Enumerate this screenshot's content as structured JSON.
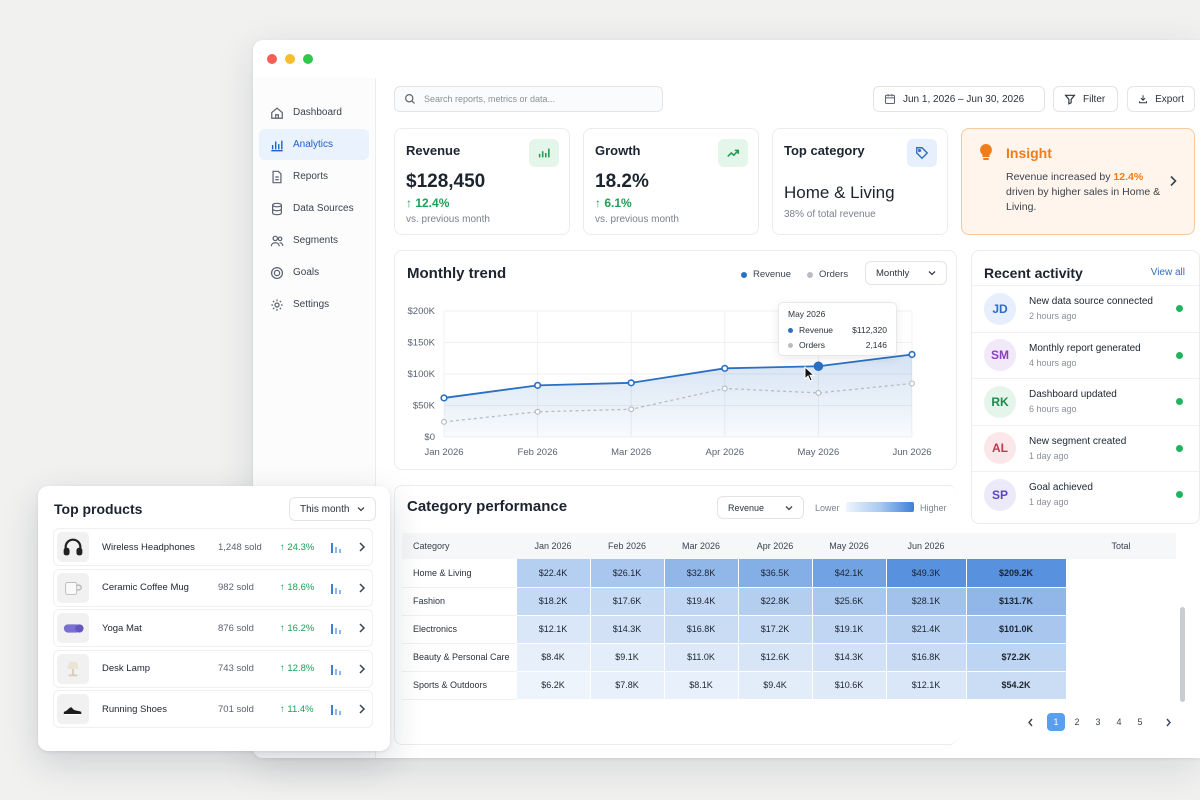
{
  "sidebar": {
    "items": [
      {
        "label": "Dashboard",
        "icon": "home-icon"
      },
      {
        "label": "Analytics",
        "icon": "bar-chart-icon"
      },
      {
        "label": "Reports",
        "icon": "document-icon"
      },
      {
        "label": "Data Sources",
        "icon": "database-icon"
      },
      {
        "label": "Segments",
        "icon": "users-icon"
      },
      {
        "label": "Goals",
        "icon": "target-icon"
      },
      {
        "label": "Settings",
        "icon": "gear-icon"
      }
    ]
  },
  "search": {
    "placeholder": "Search reports, metrics or data..."
  },
  "toolbar": {
    "date_range": "Jun 1, 2026 – Jun 30, 2026",
    "filter_label": "Filter",
    "export_label": "Export"
  },
  "kpis": {
    "revenue": {
      "title": "Revenue",
      "value": "$128,450",
      "change": "↑ 12.4%",
      "sub": "vs. previous month"
    },
    "growth": {
      "title": "Growth",
      "value": "18.2%",
      "change": "↑ 6.1%",
      "sub": "vs. previous month"
    },
    "top_category": {
      "title": "Top category",
      "value": "Home & Living",
      "sub": "38% of total revenue"
    }
  },
  "insight": {
    "title": "Insight",
    "text_before": "Revenue increased by ",
    "highlight": "12.4%",
    "text_after": " driven by higher sales in Home & Living.",
    "accent": "#f07d1a"
  },
  "trend": {
    "title": "Monthly trend",
    "legend_revenue": "Revenue",
    "legend_orders": "Orders",
    "period_select": "Monthly",
    "tooltip": {
      "month": "May 2026",
      "revenue_label": "Revenue",
      "revenue_value": "$112,320",
      "orders_label": "Orders",
      "orders_value": "2,146"
    }
  },
  "chart_data": {
    "type": "line",
    "x": [
      "Jan 2026",
      "Feb 2026",
      "Mar 2026",
      "Apr 2026",
      "May 2026",
      "Jun 2026"
    ],
    "yticks": [
      "$200K",
      "$150K",
      "$100K",
      "$50K",
      "$0"
    ],
    "ylim": [
      0,
      200000
    ],
    "series": [
      {
        "name": "Revenue",
        "values": [
          62000,
          82000,
          86000,
          109000,
          112320,
          131000
        ],
        "color": "#2a6fc4"
      },
      {
        "name": "Orders",
        "values": [
          24000,
          40000,
          44000,
          77000,
          70000,
          85000
        ],
        "color": "#b8bcc4"
      }
    ],
    "grid": true,
    "legend": "top-right"
  },
  "activity": {
    "title": "Recent activity",
    "view_all": "View all",
    "items": [
      {
        "initials": "JD",
        "text": "New data source connected",
        "time": "2 hours ago",
        "bg": "#e6effb",
        "fg": "#2e6ec2"
      },
      {
        "initials": "SM",
        "text": "Monthly report generated",
        "time": "4 hours ago",
        "bg": "#f1e8f8",
        "fg": "#8a3fbf"
      },
      {
        "initials": "RK",
        "text": "Dashboard updated",
        "time": "6 hours ago",
        "bg": "#e5f5ec",
        "fg": "#1f8a4c"
      },
      {
        "initials": "AL",
        "text": "New segment created",
        "time": "1 day ago",
        "bg": "#fbe6ea",
        "fg": "#c2384f"
      },
      {
        "initials": "SP",
        "text": "Goal achieved",
        "time": "1 day ago",
        "bg": "#ece9f9",
        "fg": "#5b47c2"
      }
    ]
  },
  "category": {
    "title": "Category performance",
    "metric_select": "Revenue",
    "scale_low": "Lower",
    "scale_high": "Higher",
    "headers": [
      "Category",
      "Jan 2026",
      "Feb 2026",
      "Mar 2026",
      "Apr 2026",
      "May 2026",
      "Jun 2026",
      "",
      "Total"
    ],
    "rows": [
      {
        "name": "Home & Living",
        "cells": [
          "$22.4K",
          "$26.1K",
          "$32.8K",
          "$36.5K",
          "$42.1K",
          "$49.3K"
        ],
        "total": "$209.2K"
      },
      {
        "name": "Fashion",
        "cells": [
          "$18.2K",
          "$17.6K",
          "$19.4K",
          "$22.8K",
          "$25.6K",
          "$28.1K"
        ],
        "total": "$131.7K"
      },
      {
        "name": "Electronics",
        "cells": [
          "$12.1K",
          "$14.3K",
          "$16.8K",
          "$17.2K",
          "$19.1K",
          "$21.4K"
        ],
        "total": "$101.0K"
      },
      {
        "name": "Beauty & Personal Care",
        "cells": [
          "$8.4K",
          "$9.1K",
          "$11.0K",
          "$12.6K",
          "$14.3K",
          "$16.8K"
        ],
        "total": "$72.2K"
      },
      {
        "name": "Sports & Outdoors",
        "cells": [
          "$6.2K",
          "$7.8K",
          "$8.1K",
          "$9.4K",
          "$10.6K",
          "$12.1K"
        ],
        "total": "$54.2K"
      }
    ],
    "pages": [
      "1",
      "2",
      "3",
      "4",
      "5"
    ]
  },
  "top_products": {
    "title": "Top products",
    "period_select": "This month",
    "items": [
      {
        "name": "Wireless Headphones",
        "sold": "1,248 sold",
        "change": "↑ 24.3%"
      },
      {
        "name": "Ceramic Coffee Mug",
        "sold": "982 sold",
        "change": "↑ 18.6%"
      },
      {
        "name": "Yoga Mat",
        "sold": "876 sold",
        "change": "↑ 16.2%"
      },
      {
        "name": "Desk Lamp",
        "sold": "743 sold",
        "change": "↑ 12.8%"
      },
      {
        "name": "Running Shoes",
        "sold": "701 sold",
        "change": "↑ 11.4%"
      }
    ]
  }
}
